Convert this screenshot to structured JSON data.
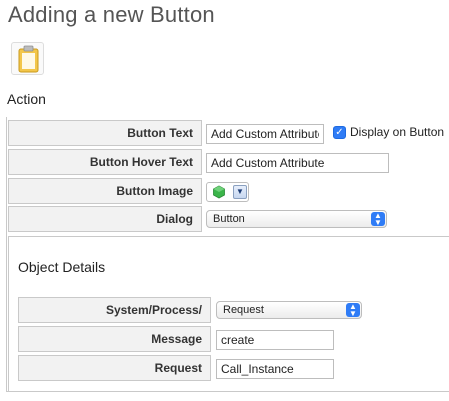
{
  "page": {
    "title": "Adding a new Button",
    "icon": "clipboard-icon"
  },
  "action": {
    "section_label": "Action",
    "rows": {
      "button_text": {
        "label": "Button Text",
        "value": "Add Custom Attribute"
      },
      "display_on_button": {
        "label": "Display on Button",
        "checked": true
      },
      "button_hover_text": {
        "label": "Button Hover Text",
        "value": "Add Custom Attribute"
      },
      "button_image": {
        "label": "Button Image",
        "icon": "green-hexagon-icon"
      },
      "dialog": {
        "label": "Dialog",
        "selected": "Button"
      }
    }
  },
  "object_details": {
    "section_label": "Object Details",
    "rows": {
      "system_process": {
        "label": "System/Process/",
        "selected": "Request"
      },
      "message": {
        "label": "Message",
        "value": "create"
      },
      "request": {
        "label": "Request",
        "value": "Call_Instance"
      }
    }
  },
  "colors": {
    "accent": "#2f7cf6",
    "label_background": "#f2f2f2",
    "border": "#c9c9c9",
    "title_text": "#555555",
    "image_icon_green": "#3bb54a"
  }
}
